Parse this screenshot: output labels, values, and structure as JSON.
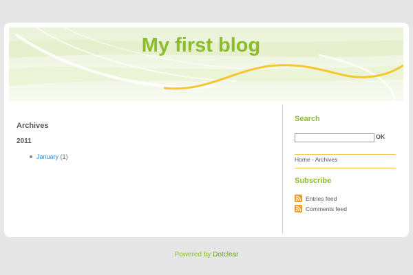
{
  "header": {
    "blog_title": "My first blog"
  },
  "main": {
    "section_title": "Archives",
    "year": "2011",
    "archive_items": [
      {
        "month": "January",
        "count": "(1)"
      }
    ]
  },
  "sidebar": {
    "search": {
      "title": "Search",
      "input_value": "",
      "button_label": "OK"
    },
    "breadcrumb": {
      "home": "Home",
      "separator": " - ",
      "current": "Archives"
    },
    "subscribe": {
      "title": "Subscribe",
      "feeds": [
        {
          "label": "Entries feed",
          "icon": "rss-icon"
        },
        {
          "label": "Comments feed",
          "icon": "rss-icon"
        }
      ]
    }
  },
  "footer": {
    "powered_by": "Powered by",
    "engine": "Dotclear"
  },
  "colors": {
    "accent_green": "#8cbc2c",
    "link_blue": "#3c8bc4",
    "rule_yellow": "#f0c040",
    "rss_orange": "#f39a2c",
    "page_background": "#e6e6e6"
  }
}
